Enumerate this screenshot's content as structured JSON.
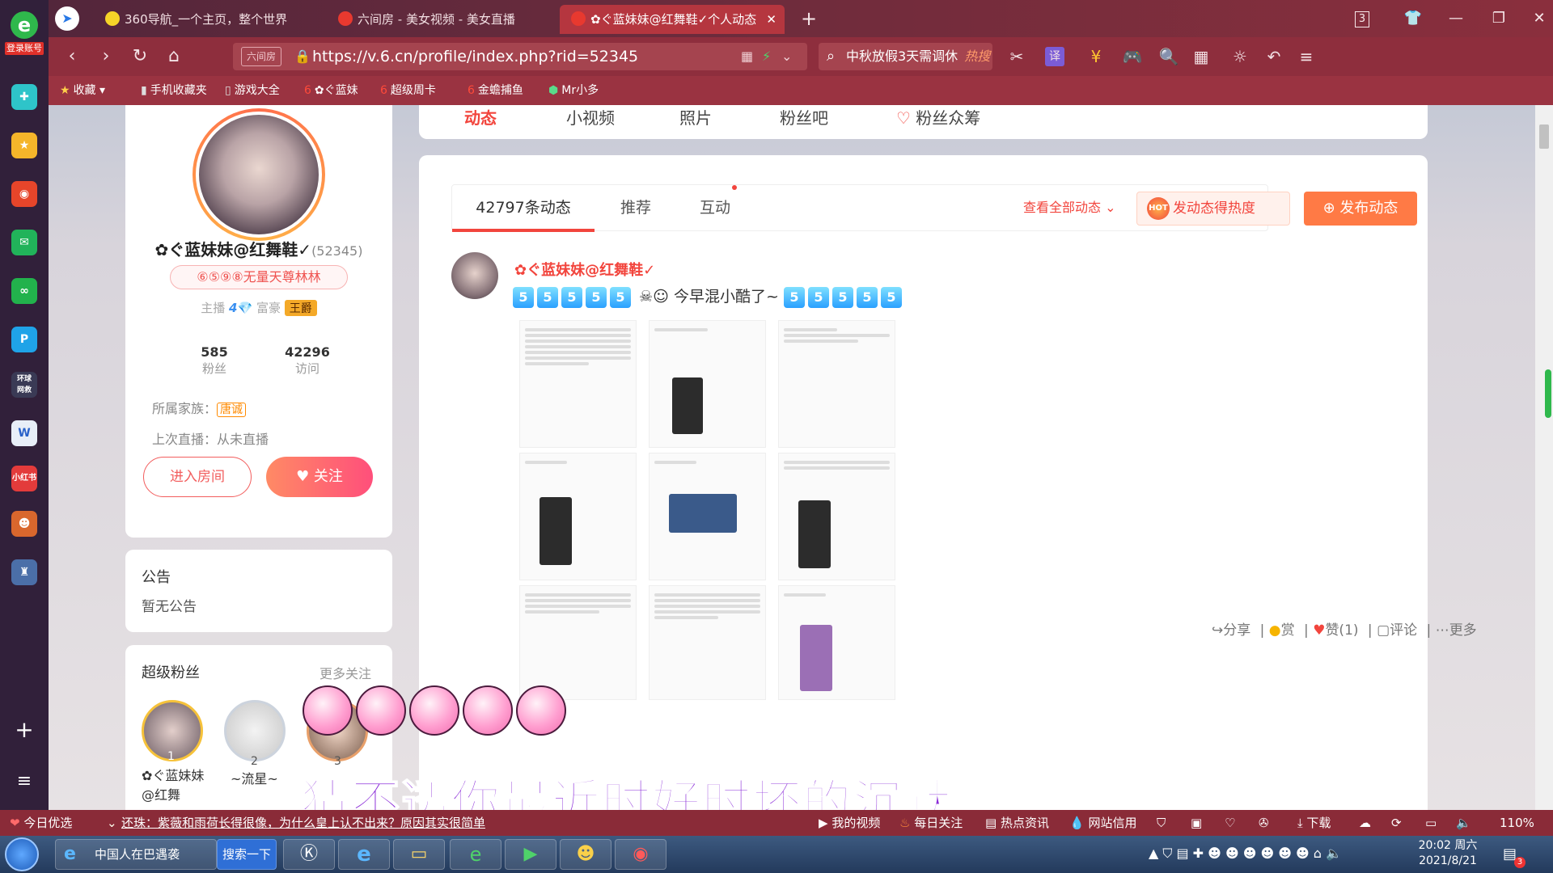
{
  "browser": {
    "tabs": [
      {
        "label": "360导航_一个主页，整个世界"
      },
      {
        "label": "六间房 - 美女视频 - 美女直播"
      },
      {
        "label": "✿ぐ蓝妹妹@红舞鞋✓个人动态"
      }
    ],
    "tab_count": "3",
    "url_tag": "六间房",
    "url": "https://v.6.cn/profile/index.php?rid=52345",
    "search_text": "中秋放假3天需调休",
    "search_hot": "热搜",
    "login_label": "登录账号",
    "zoom": "110%"
  },
  "bookmarks": [
    {
      "label": "收藏"
    },
    {
      "label": "手机收藏夹"
    },
    {
      "label": "游戏大全"
    },
    {
      "label": "✿ぐ蓝妹"
    },
    {
      "label": "超级周卡"
    },
    {
      "label": "金蟾捕鱼"
    },
    {
      "label": "Mr小多"
    }
  ],
  "profile": {
    "name": "✿ぐ蓝妹妹@红舞鞋✓",
    "id": "(52345)",
    "medal": "⑥⑤⑨⑧无量天尊林林",
    "anchor_label": "主播",
    "anchor_level": "4",
    "rich_label": "富豪",
    "rich_badge": "王爵",
    "fans_count": "585",
    "fans_label": "粉丝",
    "visits_count": "42296",
    "visits_label": "访问",
    "family_label": "所属家族：",
    "family_value": "唐诚",
    "last_live": "上次直播：从未直播",
    "enter_room": "进入房间",
    "follow": "关注"
  },
  "notice": {
    "title": "公告",
    "content": "暂无公告"
  },
  "superfans": {
    "title": "超级粉丝",
    "more": "更多关注",
    "fans": [
      {
        "rank": "1",
        "name": "✿ぐ蓝妹妹@红舞"
      },
      {
        "rank": "2",
        "name": "~流星~"
      },
      {
        "rank": "3",
        "name": ""
      }
    ]
  },
  "profile_tabs": [
    "动态",
    "小视频",
    "照片",
    "粉丝吧",
    "粉丝众筹"
  ],
  "feed": {
    "tabs": [
      {
        "label": "42797条动态"
      },
      {
        "label": "推荐"
      },
      {
        "label": "互动"
      }
    ],
    "view_all": "查看全部动态",
    "heat_button": "发动态得热度",
    "post_button": "发布动态",
    "post": {
      "author": "✿ぐ蓝妹妹@红舞鞋✓",
      "text": "今早混小酷了~",
      "actions": {
        "share": "分享",
        "reward": "赏",
        "like": "赞(1)",
        "comment": "评论",
        "more": "更多"
      }
    }
  },
  "lyric": "猜不透你最近时好时坏的沉默",
  "news": {
    "label": "今日优选",
    "headline": "还珠：紫薇和雨荷长得很像，为什么皇上认不出来？原因其实很简单",
    "items": [
      "我的视频",
      "每日关注",
      "热点资讯",
      "网站信用",
      "下载"
    ]
  },
  "taskbar": {
    "ie_label": "中国人在巴遇袭",
    "search_button": "搜索一下",
    "time": "20:02 周六",
    "date": "2021/8/21",
    "notify_count": "3"
  }
}
